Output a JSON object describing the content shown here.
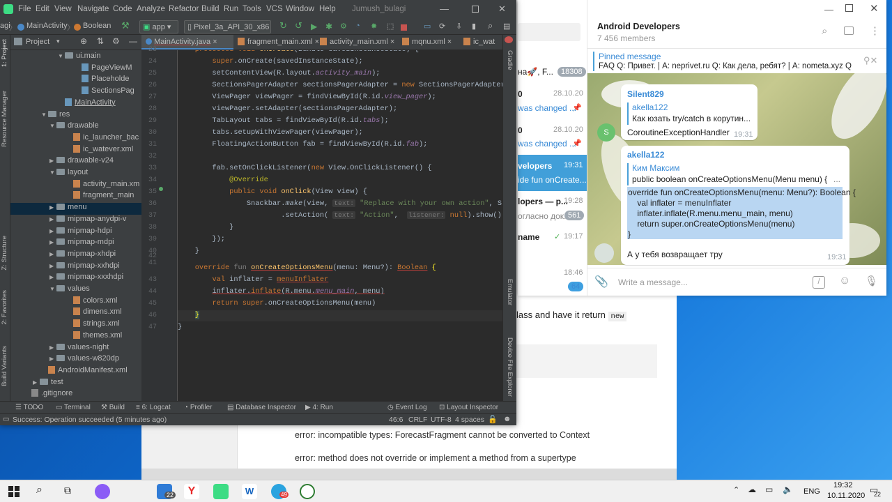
{
  "android_studio": {
    "window_title": "Jumush_bulagi",
    "menu": [
      "File",
      "Edit",
      "View",
      "Navigate",
      "Code",
      "Analyze",
      "Refactor",
      "Build",
      "Run",
      "Tools",
      "VCS",
      "Window",
      "Help"
    ],
    "breadcrumb": [
      "agi",
      "MainActivity",
      "Boolean"
    ],
    "run_config": "app",
    "device": "Pixel_3a_API_30_x86",
    "project_panel_label": "Project",
    "tabs": [
      "MainActivity.java",
      "fragment_main.xml",
      "activity_main.xml",
      "mqnu.xml",
      "ic_wat"
    ],
    "tree": [
      {
        "label": "ui.main",
        "type": "folder",
        "indent": 6,
        "open": true
      },
      {
        "label": "PageViewM",
        "type": "java",
        "indent": 8
      },
      {
        "label": "Placeholde",
        "type": "java",
        "indent": 8
      },
      {
        "label": "SectionsPag",
        "type": "java",
        "indent": 8
      },
      {
        "label": "MainActivity",
        "type": "java",
        "indent": 6,
        "link": true
      },
      {
        "label": "res",
        "type": "folder",
        "indent": 4,
        "open": true
      },
      {
        "label": "drawable",
        "type": "folder",
        "indent": 5,
        "open": true
      },
      {
        "label": "ic_launcher_bac",
        "type": "xml",
        "indent": 7
      },
      {
        "label": "ic_watever.xml",
        "type": "xml",
        "indent": 7
      },
      {
        "label": "drawable-v24",
        "type": "folder",
        "indent": 5
      },
      {
        "label": "layout",
        "type": "folder",
        "indent": 5,
        "open": true
      },
      {
        "label": "activity_main.xm",
        "type": "xml",
        "indent": 7
      },
      {
        "label": "fragment_main",
        "type": "xml",
        "indent": 7
      },
      {
        "label": "menu",
        "type": "folder",
        "indent": 5,
        "selected": true
      },
      {
        "label": "mipmap-anydpi-v",
        "type": "folder",
        "indent": 5
      },
      {
        "label": "mipmap-hdpi",
        "type": "folder",
        "indent": 5
      },
      {
        "label": "mipmap-mdpi",
        "type": "folder",
        "indent": 5
      },
      {
        "label": "mipmap-xhdpi",
        "type": "folder",
        "indent": 5
      },
      {
        "label": "mipmap-xxhdpi",
        "type": "folder",
        "indent": 5
      },
      {
        "label": "mipmap-xxxhdpi",
        "type": "folder",
        "indent": 5
      },
      {
        "label": "values",
        "type": "folder",
        "indent": 5,
        "open": true
      },
      {
        "label": "colors.xml",
        "type": "xml",
        "indent": 7
      },
      {
        "label": "dimens.xml",
        "type": "xml",
        "indent": 7
      },
      {
        "label": "strings.xml",
        "type": "xml",
        "indent": 7
      },
      {
        "label": "themes.xml",
        "type": "xml",
        "indent": 7
      },
      {
        "label": "values-night",
        "type": "folder",
        "indent": 5
      },
      {
        "label": "values-w820dp",
        "type": "folder",
        "indent": 5
      },
      {
        "label": "AndroidManifest.xml",
        "type": "xml",
        "indent": 4
      },
      {
        "label": "test",
        "type": "folder",
        "indent": 3
      },
      {
        "label": ".gitignore",
        "type": "plain",
        "indent": 2
      }
    ],
    "line_numbers": [
      "23",
      "24",
      "25",
      "26",
      "27",
      "28",
      "29",
      "30",
      "31",
      "32",
      "33",
      "34",
      "35",
      "36",
      "37",
      "38",
      "39",
      "40",
      "41",
      "42",
      "43",
      "44",
      "45",
      "46",
      "47"
    ],
    "left_tool_labels": [
      "1: Project",
      "Resource Manager",
      "Z: Structure",
      "2: Favorites",
      "Build Variants"
    ],
    "right_tool_labels": [
      "Gradle",
      "Emulator",
      "Device File Explorer"
    ],
    "bottom_tools": [
      "TODO",
      "Terminal",
      "Build",
      "6: Logcat",
      "Profiler",
      "Database Inspector",
      "4: Run",
      "Event Log",
      "Layout Inspector"
    ],
    "status_message": "Success: Operation succeeded (5 minutes ago)",
    "status_right": [
      "46:6",
      "CRLF",
      "UTF-8",
      "4 spaces"
    ]
  },
  "telegram": {
    "chat_title": "Android Developers",
    "members": "7 456 members",
    "pinned_label": "Pinned message",
    "pinned_text": "FAQ Q: Привет. | A: neprivet.ru Q: Как дела, ребят? | A: nometa.xyz  Q:...",
    "chat_list": {
      "item1_text": "на🚀, F...",
      "item1_badge": "18308",
      "item2_name": "0",
      "item2_time": "28.10.20",
      "item2_preview": "was changed ...",
      "item3_name": "0",
      "item3_time": "28.10.20",
      "item3_preview": "was changed ...",
      "item4_name": "velopers",
      "item4_time": "19:31",
      "item4_preview": "ide fun onCreate...",
      "item5_name": "lopers — p...",
      "item5_time": "19:28",
      "item5_preview": "огласно док...",
      "item5_badge": "561",
      "item6_name": "name",
      "item6_time": "19:17",
      "item7_time": "18:46",
      "item7_badge": "64"
    },
    "messages": [
      {
        "sender": "Silent829",
        "quote_author": "akella122",
        "quote_text": "Как юзать try/catch в корутин...",
        "text": "CoroutineExceptionHandler",
        "time": "19:31",
        "avatar_letter": "S"
      },
      {
        "sender": "akella122",
        "quote_author": "Ким Максим",
        "quote_text": "public boolean onCreateOptionsMenu(Menu menu) {",
        "code": [
          "override fun onCreateOptionsMenu(menu: Menu?): Boolean {",
          "    val inflater = menuInflater",
          "    inflater.inflate(R.menu.menu_main, menu)",
          "    return super.onCreateOptionsMenu(menu)",
          "}"
        ],
        "text": "А у тебя возвращает тру",
        "time": "19:31"
      }
    ],
    "compose_placeholder": "Write a message..."
  },
  "browser": {
    "snippet_text": "lass and have it return",
    "snippet_code": "new",
    "error1": "error: incompatible types: ForecastFragment cannot be converted to Context",
    "error2": "error: method does not override or implement a method from a supertype"
  },
  "taskbar": {
    "lang": "ENG",
    "time": "19:32",
    "date": "10.11.2020",
    "mail_badge": "22",
    "telegram_badge": "49",
    "notif_badge": "22"
  }
}
